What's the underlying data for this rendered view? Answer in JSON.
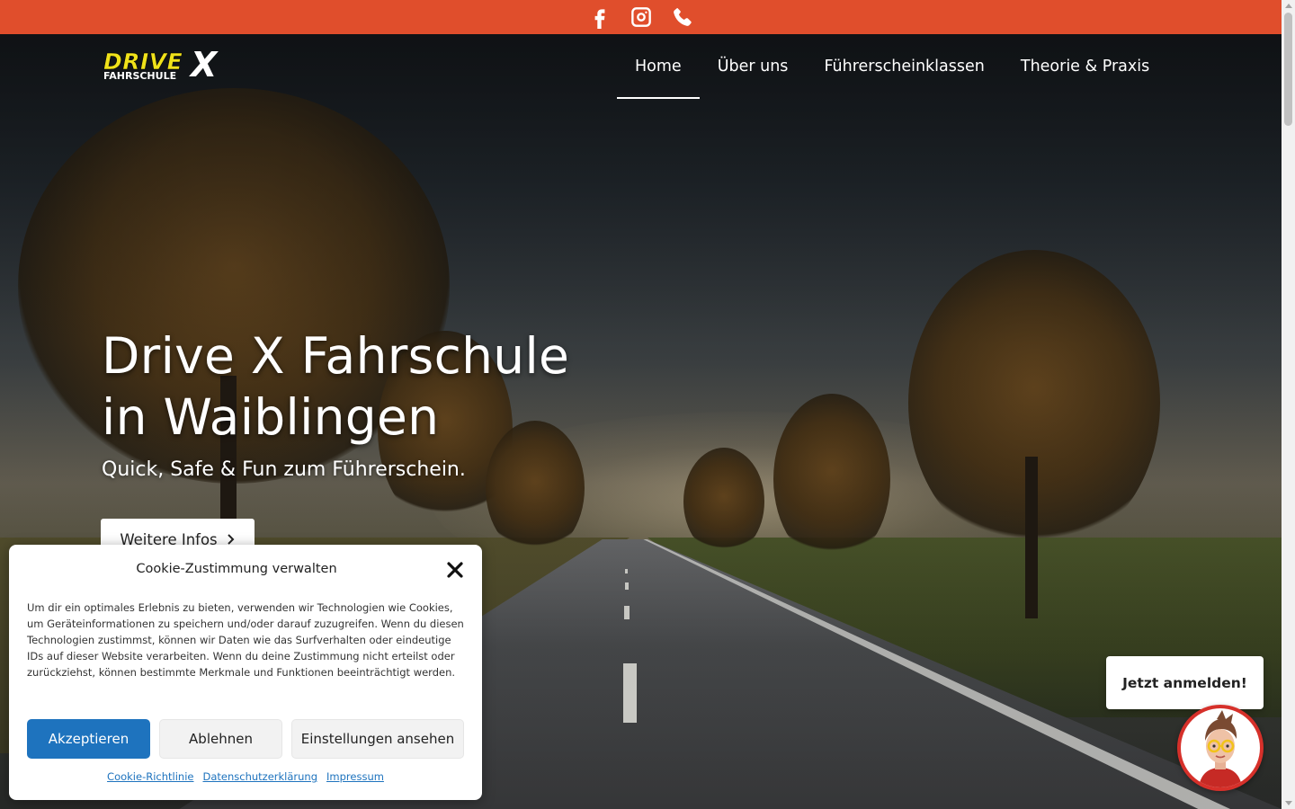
{
  "topbar": {
    "icons": [
      "facebook-icon",
      "instagram-icon",
      "phone-icon"
    ],
    "background": "#e04e2c"
  },
  "logo": {
    "word_main": "DRIVE",
    "word_sub": "FAHRSCHULE",
    "word_x": "X"
  },
  "nav": {
    "items": [
      {
        "label": "Home",
        "active": true
      },
      {
        "label": "Über uns",
        "active": false
      },
      {
        "label": "Führerscheinklassen",
        "active": false
      },
      {
        "label": "Theorie & Praxis",
        "active": false
      }
    ]
  },
  "hero": {
    "title_line1": "Drive X Fahrschule",
    "title_line2": "in Waiblingen",
    "subtitle": "Quick, Safe & Fun zum Führerschein.",
    "cta_label": "Weitere Infos"
  },
  "cookie": {
    "title": "Cookie-Zustimmung verwalten",
    "text": "Um dir ein optimales Erlebnis zu bieten, verwenden wir Technologien wie Cookies, um Geräteinformationen zu speichern und/oder darauf zuzugreifen. Wenn du diesen Technologien zustimmst, können wir Daten wie das Surfverhalten oder eindeutige IDs auf dieser Website verarbeiten. Wenn du deine Zustimmung nicht erteilst oder zurückziehst, können bestimmte Merkmale und Funktionen beeinträchtigt werden.",
    "accept_label": "Akzeptieren",
    "deny_label": "Ablehnen",
    "prefs_label": "Einstellungen ansehen",
    "links": [
      "Cookie-Richtlinie",
      "Datenschutzerklärung",
      "Impressum"
    ],
    "accent": "#1e73be"
  },
  "chat": {
    "bubble_label": "Jetzt anmelden!",
    "avatar_ring": "#d6302a"
  }
}
